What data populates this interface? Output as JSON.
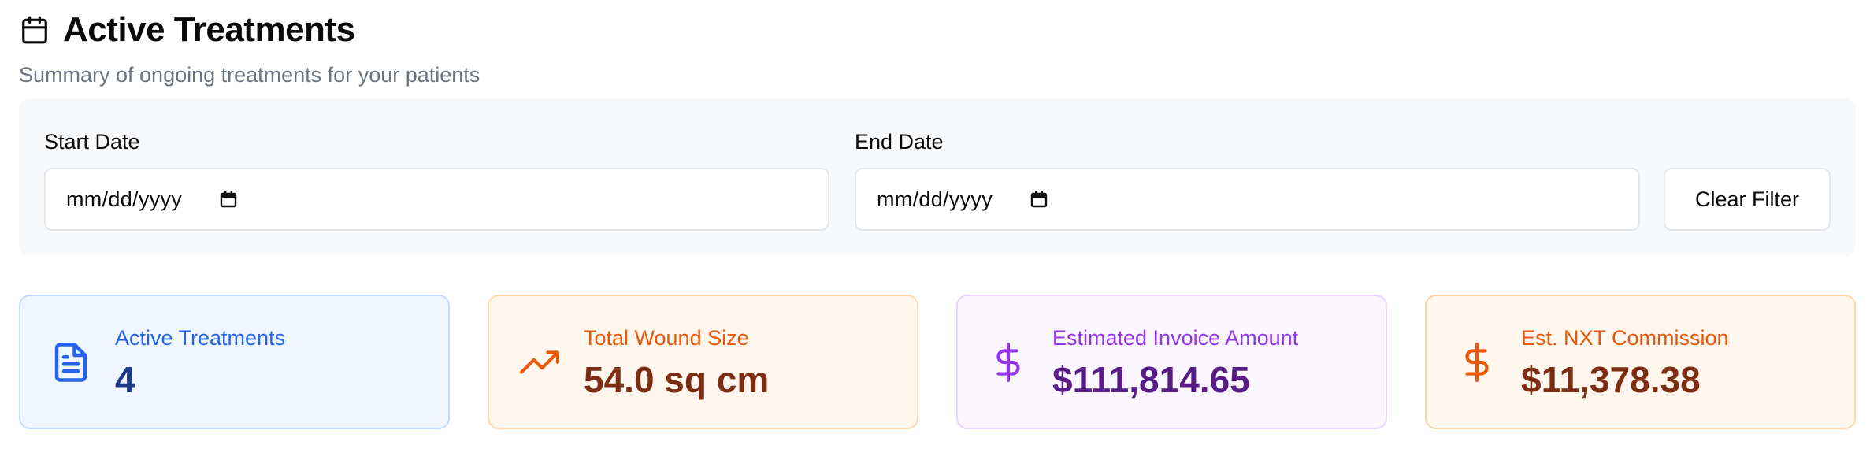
{
  "header": {
    "title": "Active Treatments",
    "icon": "calendar-icon",
    "subtitle": "Summary of ongoing treatments for your patients"
  },
  "filters": {
    "start_date": {
      "label": "Start Date",
      "value": "mm/dd/yyyy",
      "icon": "calendar-icon"
    },
    "end_date": {
      "label": "End Date",
      "value": "mm/dd/yyyy",
      "icon": "calendar-icon"
    },
    "clear_label": "Clear Filter"
  },
  "stats": [
    {
      "label": "Active Treatments",
      "value": "4",
      "icon": "file-text-icon",
      "accent": "#2563eb"
    },
    {
      "label": "Total Wound Size",
      "value": "54.0 sq cm",
      "icon": "trending-up-icon",
      "accent": "#ea580c"
    },
    {
      "label": "Estimated Invoice Amount",
      "value": "$111,814.65",
      "icon": "dollar-icon",
      "accent": "#9333ea"
    },
    {
      "label": "Est. NXT Commission",
      "value": "$11,378.38",
      "icon": "dollar-icon",
      "accent": "#ea580c"
    }
  ]
}
